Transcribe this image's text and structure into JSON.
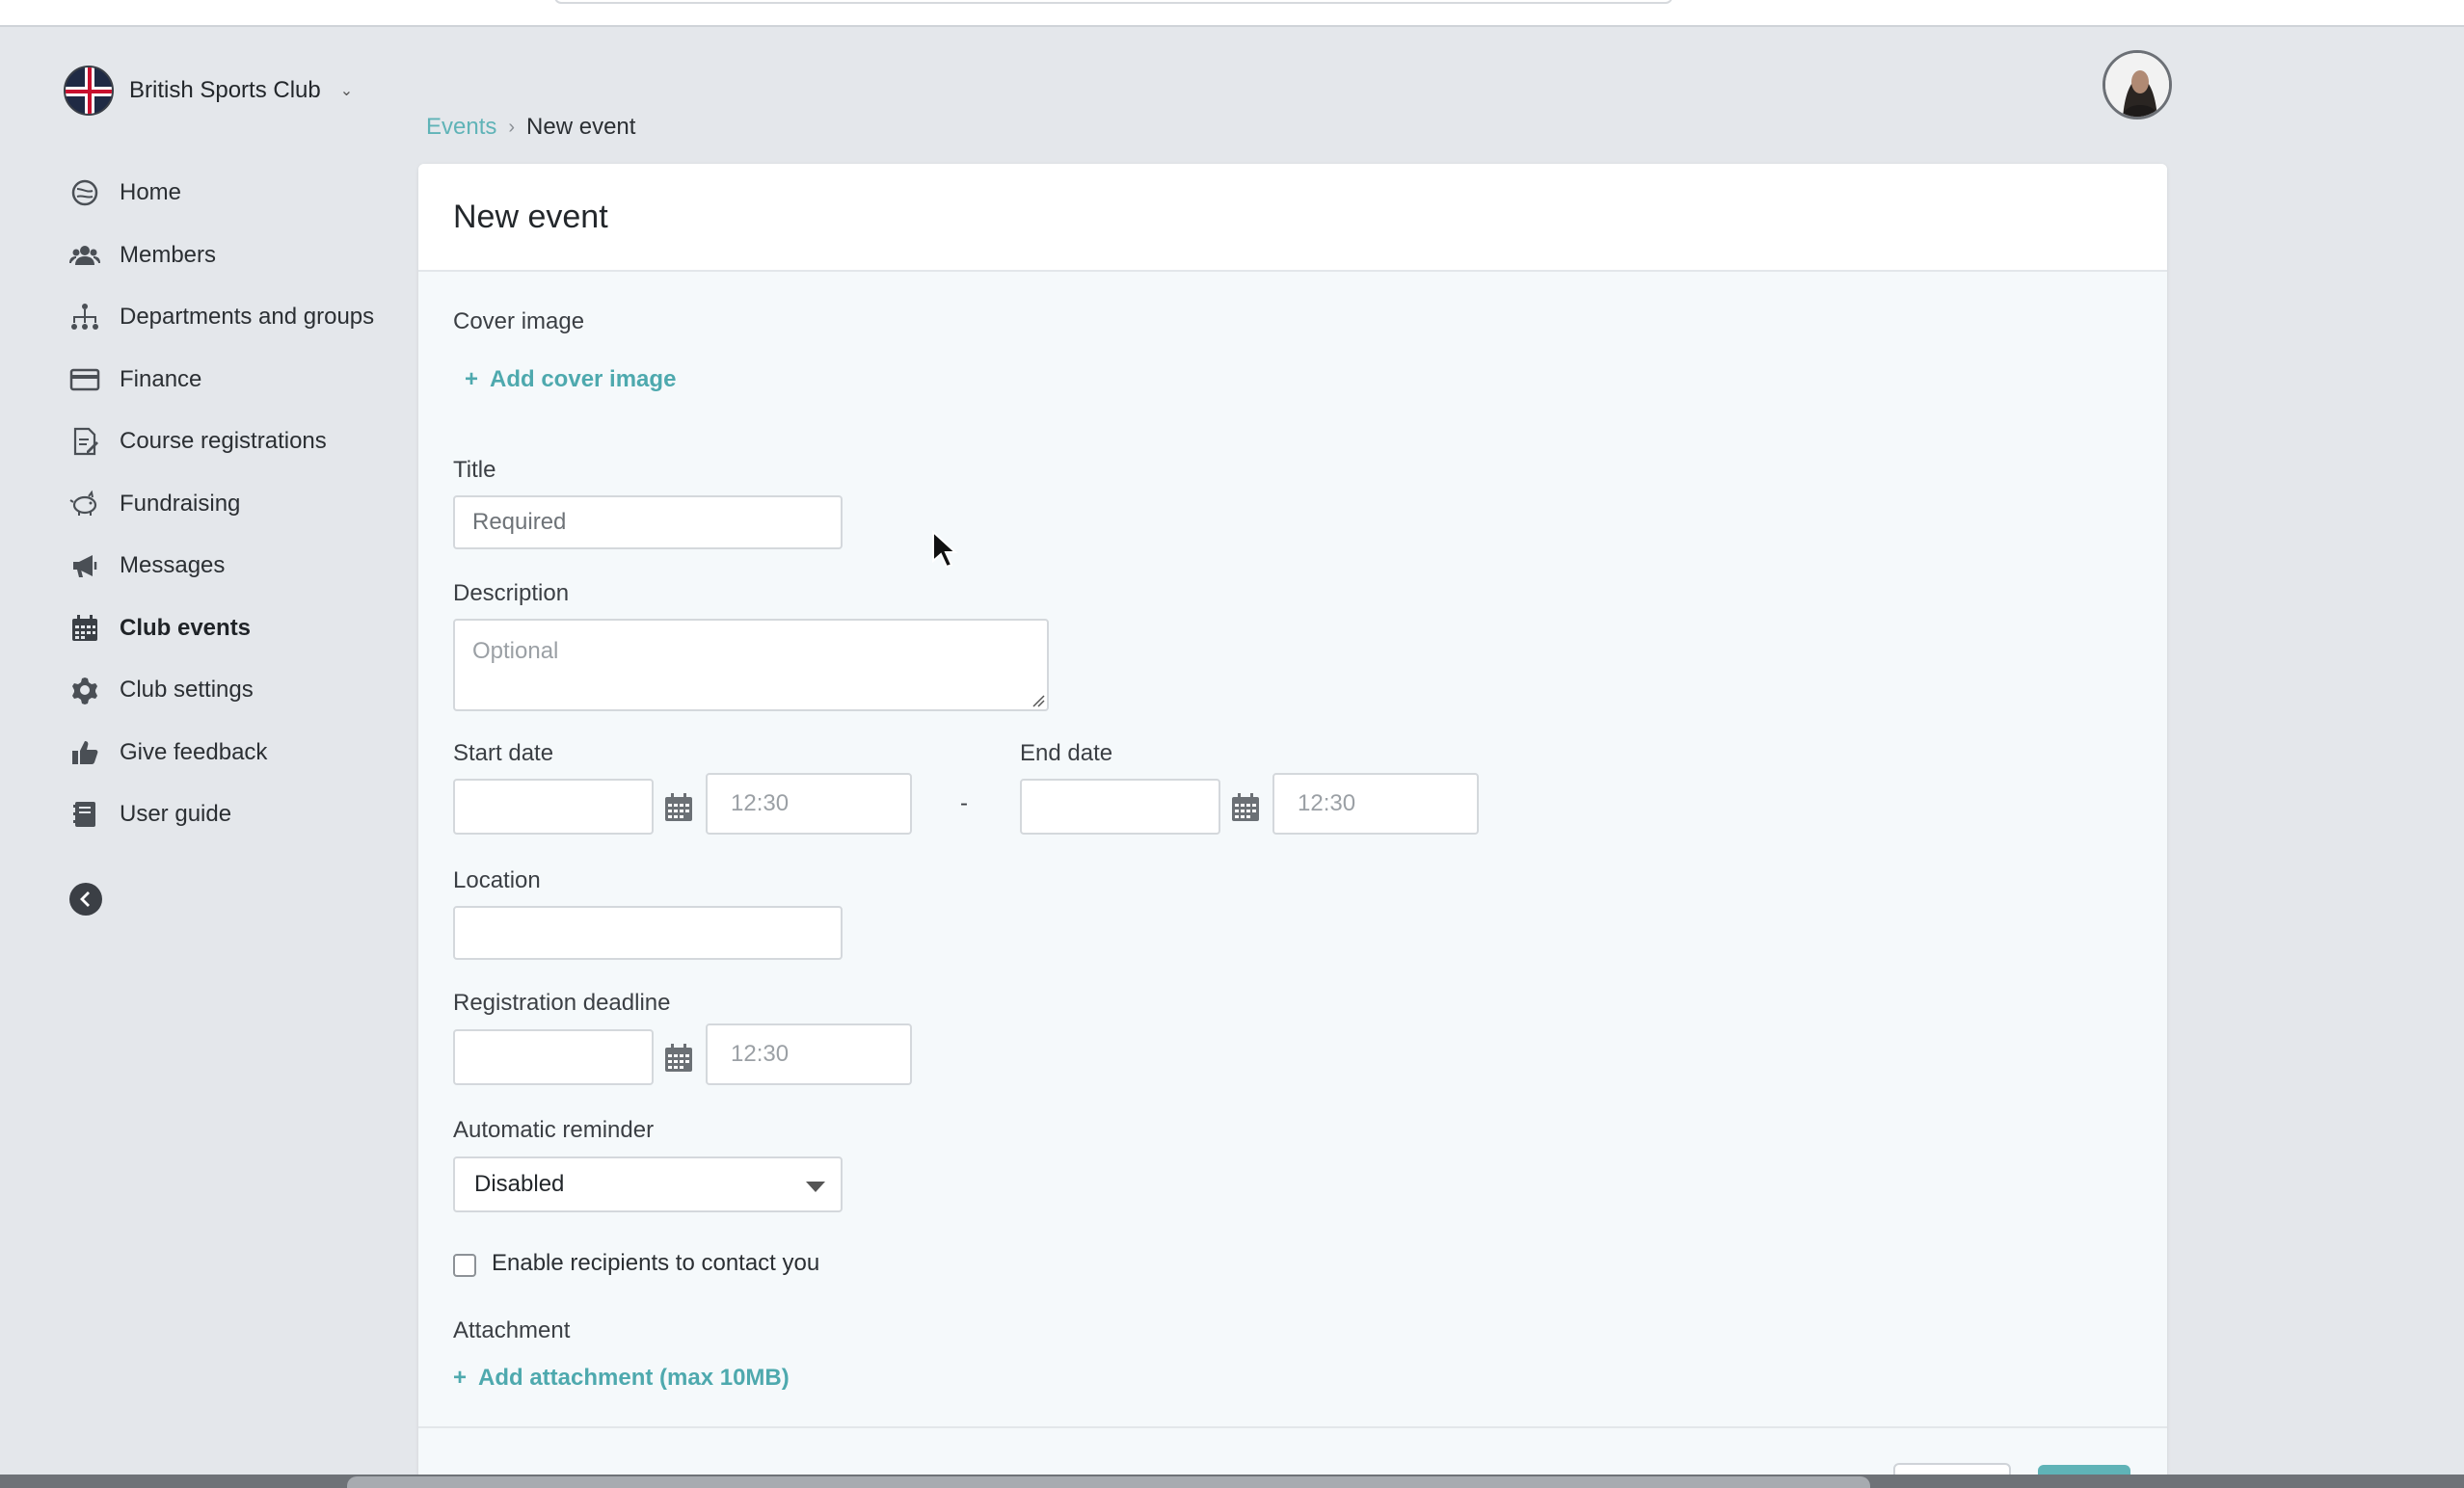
{
  "club": {
    "name": "British Sports Club"
  },
  "sidebar": {
    "items": [
      {
        "label": "Home",
        "icon": "home-icon",
        "active": false
      },
      {
        "label": "Members",
        "icon": "members-icon",
        "active": false
      },
      {
        "label": "Departments and groups",
        "icon": "hierarchy-icon",
        "active": false
      },
      {
        "label": "Finance",
        "icon": "credit-card-icon",
        "active": false
      },
      {
        "label": "Course registrations",
        "icon": "document-edit-icon",
        "active": false
      },
      {
        "label": "Fundraising",
        "icon": "piggy-bank-icon",
        "active": false
      },
      {
        "label": "Messages",
        "icon": "megaphone-icon",
        "active": false
      },
      {
        "label": "Club events",
        "icon": "calendar-icon",
        "active": true
      },
      {
        "label": "Club settings",
        "icon": "gear-icon",
        "active": false
      },
      {
        "label": "Give feedback",
        "icon": "thumbs-up-icon",
        "active": false
      },
      {
        "label": "User guide",
        "icon": "book-icon",
        "active": false
      }
    ]
  },
  "breadcrumb": {
    "parent": "Events",
    "separator": "›",
    "current": "New event"
  },
  "form": {
    "title": "New event",
    "cover_image_label": "Cover image",
    "add_cover_image": "Add cover image",
    "plus": "+",
    "title_label": "Title",
    "title_placeholder": "Required",
    "description_label": "Description",
    "description_placeholder": "Optional",
    "start_date_label": "Start date",
    "start_time": "12:30",
    "end_date_label": "End date",
    "end_time": "12:30",
    "date_separator": "-",
    "location_label": "Location",
    "deadline_label": "Registration deadline",
    "deadline_time": "12:30",
    "reminder_label": "Automatic reminder",
    "reminder_value": "Disabled",
    "contact_label": "Enable recipients to contact you",
    "contact_checked": false,
    "attachment_label": "Attachment",
    "add_attachment": "Add attachment (max 10MB)"
  },
  "colors": {
    "accent": "#4ea9ae",
    "background": "#e4e7eb",
    "card": "#f5f9fb"
  }
}
